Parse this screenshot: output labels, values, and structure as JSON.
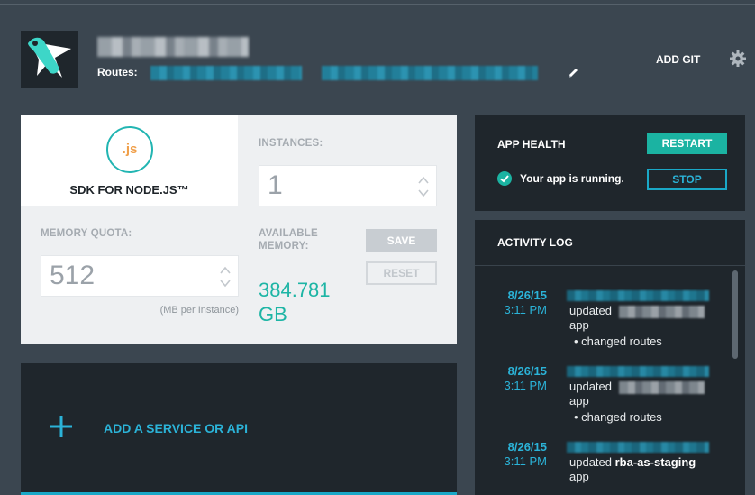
{
  "header": {
    "routes_label": "Routes:",
    "add_git_label": "ADD GIT",
    "icons": {
      "logo": "rocket-logo-icon",
      "edit": "pencil-icon",
      "settings": "gear-icon"
    }
  },
  "runtime": {
    "sdk_badge": ".js",
    "sdk_name": "SDK FOR NODE.JS™",
    "instances_label": "INSTANCES:",
    "instances_value": "1",
    "memory_quota_label": "MEMORY QUOTA:",
    "memory_quota_value": "512",
    "memory_unit_note": "(MB per Instance)",
    "available_memory_label": "AVAILABLE MEMORY:",
    "available_memory_value": "384.781 GB",
    "save_label": "SAVE",
    "reset_label": "RESET"
  },
  "service": {
    "add_label": "ADD A SERVICE OR API"
  },
  "health": {
    "title": "APP HEALTH",
    "restart_label": "RESTART",
    "status_text": "Your app is running.",
    "stop_label": "STOP"
  },
  "activity_log": {
    "title": "ACTIVITY LOG",
    "entries": [
      {
        "date": "8/26/15",
        "time": "3:11 PM",
        "action": "updated",
        "app_name": "",
        "app_suffix": "app",
        "change": "changed routes"
      },
      {
        "date": "8/26/15",
        "time": "3:11 PM",
        "action": "updated",
        "app_name": "",
        "app_suffix": "app",
        "change": "changed routes"
      },
      {
        "date": "8/26/15",
        "time": "3:11 PM",
        "action": "updated",
        "app_name": "rba-as-staging",
        "app_suffix": "app",
        "change": ""
      }
    ]
  },
  "colors": {
    "background": "#3b4650",
    "panel_dark": "#1f262c",
    "panel_light": "#eef0f2",
    "accent_teal": "#1bb3a2",
    "accent_blue": "#2bb3d8",
    "sdk_orange": "#f0a04b"
  }
}
